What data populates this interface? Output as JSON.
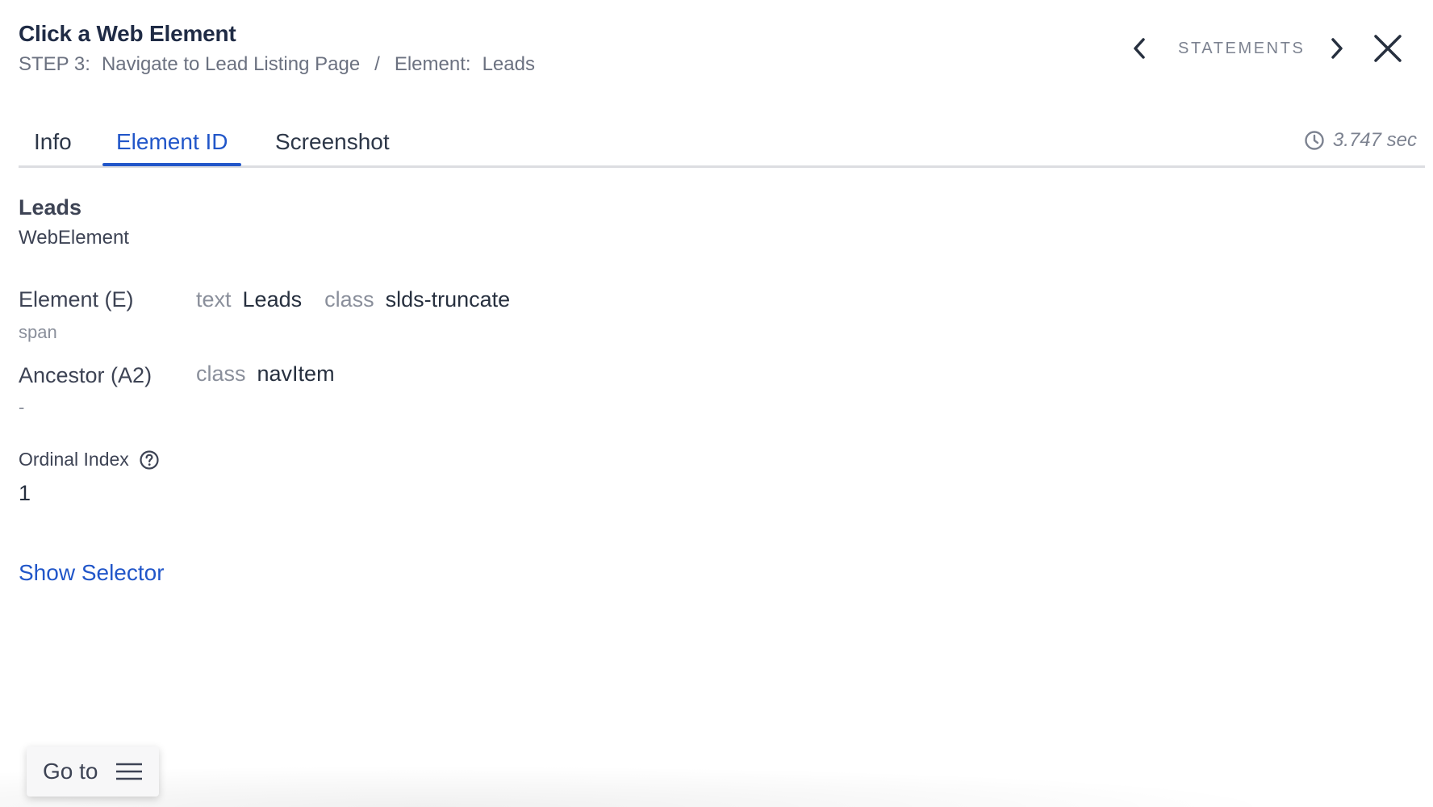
{
  "header": {
    "title": "Click a Web Element",
    "breadcrumb": {
      "step": "STEP 3:",
      "step_name": "Navigate to Lead Listing Page",
      "separator": "/",
      "element_label": "Element:",
      "element_name": "Leads"
    },
    "statements_label": "STATEMENTS",
    "icons": {
      "prev": "chevron-left-icon",
      "next": "chevron-right-icon",
      "close": "close-icon"
    }
  },
  "tabs": [
    {
      "label": "Info",
      "active": false
    },
    {
      "label": "Element ID",
      "active": true
    },
    {
      "label": "Screenshot",
      "active": false
    }
  ],
  "timer": {
    "icon": "clock-icon",
    "value": "3.747 sec"
  },
  "element": {
    "name": "Leads",
    "type": "WebElement"
  },
  "rows": [
    {
      "label": "Element (E)",
      "sub": "span",
      "attrs": [
        {
          "key": "text",
          "value": "Leads"
        },
        {
          "key": "class",
          "value": "slds-truncate"
        }
      ]
    },
    {
      "label": "Ancestor (A2)",
      "sub": "-",
      "attrs": [
        {
          "key": "class",
          "value": "navItem"
        }
      ]
    }
  ],
  "ordinal": {
    "label": "Ordinal Index",
    "icon": "help-circle-icon",
    "value": "1"
  },
  "show_selector_label": "Show Selector",
  "goto": {
    "label": "Go to",
    "icon": "hamburger-menu-icon"
  },
  "colors": {
    "accent": "#2156c9",
    "title": "#1f2b45",
    "muted": "#8a8f9b",
    "divider": "#dcdde1"
  }
}
